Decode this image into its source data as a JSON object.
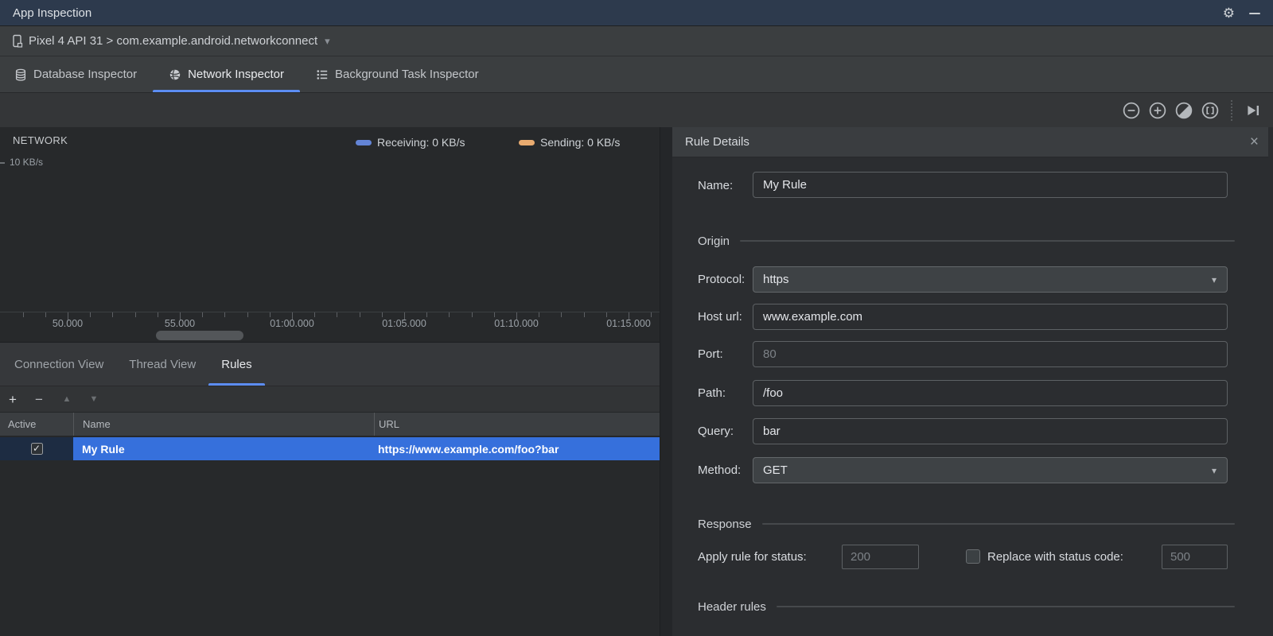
{
  "icons": {
    "gear": "⚙",
    "chevron_down": "▾",
    "dropdown_arrow": "▾",
    "close": "×",
    "check": "✓",
    "plus": "+",
    "minus": "−",
    "up": "▲",
    "down": "▼"
  },
  "titlebar": {
    "title": "App Inspection"
  },
  "device_bar": {
    "label": "Pixel 4 API 31 > com.example.android.networkconnect"
  },
  "inspector_tabs": [
    {
      "label": "Database Inspector",
      "selected": false
    },
    {
      "label": "Network Inspector",
      "selected": true
    },
    {
      "label": "Background Task Inspector",
      "selected": false
    }
  ],
  "chart": {
    "title": "NETWORK",
    "y_axis_label": "10 KB/s",
    "legend": [
      {
        "label": "Receiving: 0 KB/s",
        "color": "#6384d6"
      },
      {
        "label": "Sending: 0 KB/s",
        "color": "#e9ab70"
      }
    ],
    "x_ticks": [
      "50.000",
      "55.000",
      "01:00.000",
      "01:05.000",
      "01:10.000",
      "01:15.000"
    ],
    "series": [
      {
        "name": "Receiving",
        "current_value_kbps": 0
      },
      {
        "name": "Sending",
        "current_value_kbps": 0
      }
    ]
  },
  "view_tabs": [
    {
      "label": "Connection View",
      "selected": false
    },
    {
      "label": "Thread View",
      "selected": false
    },
    {
      "label": "Rules",
      "selected": true
    }
  ],
  "rules_table": {
    "columns": [
      "Active",
      "Name",
      "URL"
    ],
    "rows": [
      {
        "active": true,
        "name": "My Rule",
        "url": "https://www.example.com/foo?bar",
        "selected": true
      }
    ]
  },
  "rule_details": {
    "title": "Rule Details",
    "name_label": "Name:",
    "name_value": "My Rule",
    "origin_section": "Origin",
    "origin": {
      "protocol_label": "Protocol:",
      "protocol_value": "https",
      "host_label": "Host url:",
      "host_value": "www.example.com",
      "port_label": "Port:",
      "port_placeholder": "80",
      "path_label": "Path:",
      "path_value": "/foo",
      "query_label": "Query:",
      "query_value": "bar",
      "method_label": "Method:",
      "method_value": "GET"
    },
    "response_section": "Response",
    "response": {
      "apply_label": "Apply rule for status:",
      "apply_placeholder": "200",
      "replace_label": "Replace with status code:",
      "replace_placeholder": "500",
      "replace_checked": false
    },
    "header_rules_section": "Header rules"
  }
}
